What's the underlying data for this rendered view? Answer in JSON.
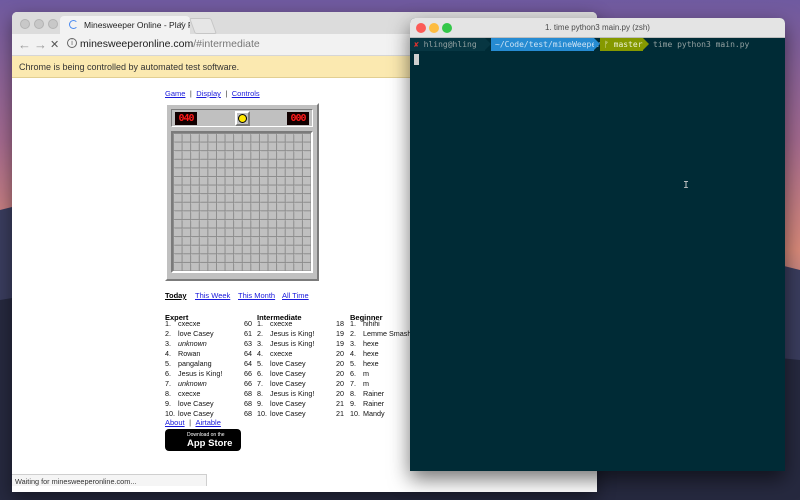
{
  "browser": {
    "tab_title": "Minesweeper Online - Play Fr...",
    "tab_close": "×",
    "back_icon": "←",
    "forward_icon": "→",
    "reload_icon": "✕",
    "info_icon": "i",
    "url_domain": "minesweeperonline.com",
    "url_path": "/#intermediate",
    "infobar_text": "Chrome is being controlled by automated test software.",
    "status_text": "Waiting for minesweeperonline.com..."
  },
  "page": {
    "menu": [
      "Game",
      "Display",
      "Controls"
    ],
    "separator": "|",
    "mines_counter": "040",
    "timer_counter": "000",
    "ranking_tabs": [
      "Today",
      "This Week",
      "This Month",
      "All Time"
    ],
    "leaderboards": [
      {
        "title": "Expert",
        "rows": [
          {
            "rank": "1.",
            "name": "cxecxe",
            "score": "60",
            "italic": false
          },
          {
            "rank": "2.",
            "name": "love Casey",
            "score": "61",
            "italic": false
          },
          {
            "rank": "3.",
            "name": "unknown",
            "score": "63",
            "italic": true
          },
          {
            "rank": "4.",
            "name": "Rowan",
            "score": "64",
            "italic": false
          },
          {
            "rank": "5.",
            "name": "pangalang",
            "score": "64",
            "italic": false
          },
          {
            "rank": "6.",
            "name": "Jesus is King!",
            "score": "66",
            "italic": false
          },
          {
            "rank": "7.",
            "name": "unknown",
            "score": "66",
            "italic": true
          },
          {
            "rank": "8.",
            "name": "cxecxe",
            "score": "68",
            "italic": false
          },
          {
            "rank": "9.",
            "name": "love Casey",
            "score": "68",
            "italic": false
          },
          {
            "rank": "10.",
            "name": "love Casey",
            "score": "68",
            "italic": false
          }
        ]
      },
      {
        "title": "Intermediate",
        "rows": [
          {
            "rank": "1.",
            "name": "cxecxe",
            "score": "18",
            "italic": false
          },
          {
            "rank": "2.",
            "name": "Jesus is King!",
            "score": "19",
            "italic": false
          },
          {
            "rank": "3.",
            "name": "Jesus is King!",
            "score": "19",
            "italic": false
          },
          {
            "rank": "4.",
            "name": "cxecxe",
            "score": "20",
            "italic": false
          },
          {
            "rank": "5.",
            "name": "love Casey",
            "score": "20",
            "italic": false
          },
          {
            "rank": "6.",
            "name": "love Casey",
            "score": "20",
            "italic": false
          },
          {
            "rank": "7.",
            "name": "love Casey",
            "score": "20",
            "italic": false
          },
          {
            "rank": "8.",
            "name": "Jesus is King!",
            "score": "20",
            "italic": false
          },
          {
            "rank": "9.",
            "name": "love Casey",
            "score": "21",
            "italic": false
          },
          {
            "rank": "10.",
            "name": "love Casey",
            "score": "21",
            "italic": false
          }
        ]
      },
      {
        "title": "Beginner",
        "rows": [
          {
            "rank": "1.",
            "name": "hihihi",
            "score": "",
            "italic": false
          },
          {
            "rank": "2.",
            "name": "Lemme Smash",
            "score": "",
            "italic": false
          },
          {
            "rank": "3.",
            "name": "hexe",
            "score": "",
            "italic": false
          },
          {
            "rank": "4.",
            "name": "hexe",
            "score": "",
            "italic": false
          },
          {
            "rank": "5.",
            "name": "hexe",
            "score": "",
            "italic": false
          },
          {
            "rank": "6.",
            "name": "m",
            "score": "",
            "italic": false
          },
          {
            "rank": "7.",
            "name": "m",
            "score": "",
            "italic": false
          },
          {
            "rank": "8.",
            "name": "Rainer",
            "score": "",
            "italic": false
          },
          {
            "rank": "9.",
            "name": "Rainer",
            "score": "",
            "italic": false
          },
          {
            "rank": "10.",
            "name": "Mandy",
            "score": "",
            "italic": false
          }
        ]
      }
    ],
    "footer_links": [
      "About",
      "Airtable"
    ],
    "appstore_small": "Download on the",
    "appstore_big": "App Store",
    "apple_icon": ""
  },
  "terminal": {
    "title": "1. time python3 main.py (zsh)",
    "status_icon": "✘",
    "user_host": "hling@hling",
    "cwd": "~/Code/test/mineWeeper",
    "branch_icon": "ᚠ",
    "branch": "master",
    "command": "time python3 main.py",
    "ibeam": "I"
  },
  "colors": {
    "terminal_bg": "#002b36",
    "prompt_user_bg": "#073642",
    "prompt_cwd_bg": "#268bd2",
    "prompt_git_bg": "#859900",
    "error_x": "#dc322f",
    "infobar_bg": "#fbe9b0",
    "link": "#1a1adc"
  }
}
